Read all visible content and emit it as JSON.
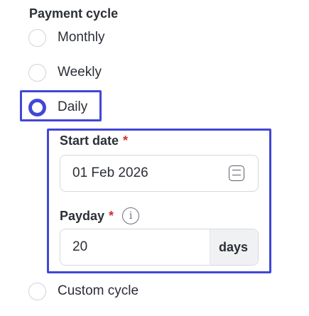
{
  "payment_cycle": {
    "legend": "Payment cycle",
    "options": [
      {
        "label": "Monthly",
        "selected": false
      },
      {
        "label": "Weekly",
        "selected": false
      },
      {
        "label": "Daily",
        "selected": true
      },
      {
        "label": "Custom cycle",
        "selected": false
      }
    ]
  },
  "daily_settings": {
    "start_date": {
      "label": "Start date",
      "required_mark": "*",
      "value": "01 Feb 2026",
      "icon": "calendar-icon"
    },
    "payday": {
      "label": "Payday",
      "required_mark": "*",
      "info_icon": "i",
      "value": "20",
      "suffix": "days"
    }
  },
  "colors": {
    "accent": "#4147d6",
    "required": "#d32f2f",
    "text": "#2b2f36",
    "border": "#d5d9de"
  }
}
